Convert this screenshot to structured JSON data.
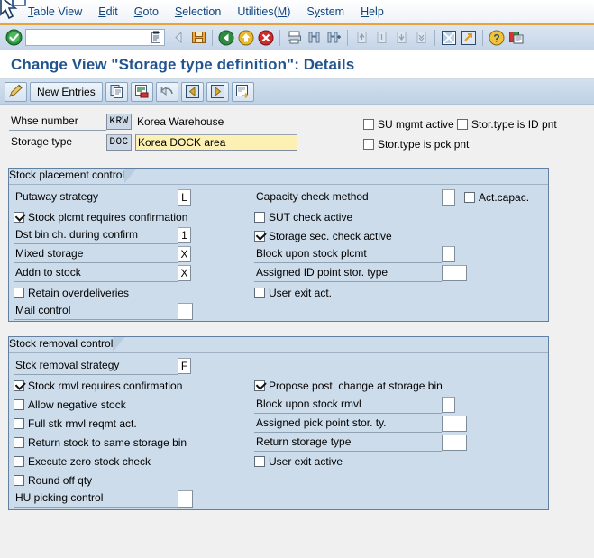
{
  "window": {
    "title": "Change View \"Storage type definition\": Details"
  },
  "menu": {
    "items": [
      {
        "label": "Table View",
        "accel": "T"
      },
      {
        "label": "Edit",
        "accel": "E"
      },
      {
        "label": "Goto",
        "accel": "G"
      },
      {
        "label": "Selection",
        "accel": "S"
      },
      {
        "label": "Utilities(M)",
        "accel": "M"
      },
      {
        "label": "System",
        "accel": "y"
      },
      {
        "label": "Help",
        "accel": "H"
      }
    ]
  },
  "system_toolbar": {
    "enter_icon": "green-check-icon",
    "command_field": {
      "value": "",
      "placeholder": "",
      "dropdown_icon": "command-dropdown-icon"
    },
    "buttons": [
      "back-nav-icon",
      "save-icon",
      "back-green-icon",
      "exit-yellow-icon",
      "cancel-red-icon",
      "print-icon",
      "find-icon",
      "find-next-icon",
      "first-page-icon",
      "previous-page-icon",
      "next-page-icon",
      "last-page-icon",
      "new-session-icon",
      "create-shortcut-icon",
      "help-icon",
      "customize-local-layout-icon"
    ]
  },
  "app_toolbar": {
    "display_change_label": "",
    "new_entries_label": "New Entries",
    "buttons": [
      "display-change-icon",
      "copy-icon",
      "delete-icon",
      "undo-icon",
      "previous-entry-icon",
      "next-entry-icon",
      "other-entry-icon"
    ]
  },
  "header": {
    "whse_number": {
      "label": "Whse number",
      "value": "KRW",
      "description": "Korea Warehouse"
    },
    "storage_type": {
      "label": "Storage type",
      "value": "DOC",
      "description": "Korea DOCK area"
    },
    "flags": [
      {
        "label": "SU mgmt active",
        "checked": false
      },
      {
        "label": "Stor.type is ID pnt",
        "checked": false
      },
      {
        "label": "Stor.type is pck pnt",
        "checked": false
      }
    ]
  },
  "stock_placement_control": {
    "title": "Stock placement control",
    "left": [
      {
        "type": "field",
        "label": "Putaway strategy",
        "value": "L"
      },
      {
        "type": "check",
        "label": "Stock plcmt requires confirmation",
        "checked": true
      },
      {
        "type": "field",
        "label": "Dst bin ch. during confirm",
        "value": "1"
      },
      {
        "type": "field",
        "label": "Mixed storage",
        "value": "X"
      },
      {
        "type": "field",
        "label": "Addn to stock",
        "value": "X"
      },
      {
        "type": "check",
        "label": "Retain overdeliveries",
        "checked": false
      },
      {
        "type": "field",
        "label": "Mail control",
        "value": ""
      }
    ],
    "right": [
      {
        "type": "field",
        "label": "Capacity check method",
        "value": ""
      },
      {
        "type": "check",
        "label": "SUT check active",
        "checked": false
      },
      {
        "type": "check",
        "label": "Storage sec. check active",
        "checked": true
      },
      {
        "type": "field",
        "label": "Block upon stock plcmt",
        "value": ""
      },
      {
        "type": "field",
        "label": "Assigned ID point stor. type",
        "value": ""
      },
      {
        "type": "check",
        "label": "User exit act.",
        "checked": false
      }
    ],
    "act_capac": {
      "label": "Act.capac.",
      "checked": false
    }
  },
  "stock_removal_control": {
    "title": "Stock removal control",
    "left": [
      {
        "type": "field",
        "label": "Stck removal strategy",
        "value": "F"
      },
      {
        "type": "check",
        "label": "Stock rmvl requires confirmation",
        "checked": true
      },
      {
        "type": "check",
        "label": "Allow negative stock",
        "checked": false
      },
      {
        "type": "check",
        "label": "Full stk rmvl reqmt act.",
        "checked": false
      },
      {
        "type": "check",
        "label": "Return stock to same storage bin",
        "checked": false
      },
      {
        "type": "check",
        "label": "Execute zero stock check",
        "checked": false
      },
      {
        "type": "check",
        "label": "Round off qty",
        "checked": false
      },
      {
        "type": "field",
        "label": "HU picking control",
        "value": ""
      }
    ],
    "right": [
      {
        "type": "check",
        "label": "Propose post. change at storage bin",
        "checked": true
      },
      {
        "type": "field",
        "label": "Block upon stock rmvl",
        "value": ""
      },
      {
        "type": "field",
        "label": "Assigned pick point stor. ty.",
        "value": ""
      },
      {
        "type": "field",
        "label": "Return storage type",
        "value": ""
      },
      {
        "type": "check",
        "label": "User exit active",
        "checked": false
      }
    ]
  },
  "colors": {
    "title_blue": "#22548f",
    "menu_blue": "#10447e",
    "accent_orange": "#e8a33d",
    "group_bg": "#cddcea",
    "group_border": "#62809f",
    "required_yellow": "#fcf0b2",
    "key_field_bg": "#cdd8e6",
    "canvas_bg": "#f0f0f0"
  }
}
